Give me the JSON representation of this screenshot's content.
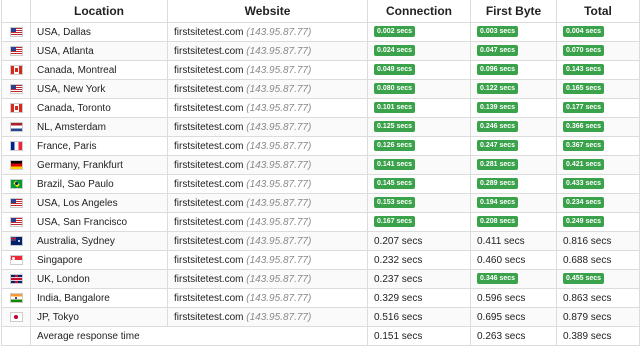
{
  "headers": {
    "flag": "",
    "location": "Location",
    "website": "Website",
    "connection": "Connection",
    "first_byte": "First Byte",
    "total": "Total"
  },
  "colors": {
    "badge_green": "#3aa24a",
    "ip_gray": "#8a8a8a",
    "border": "#dcdcdc"
  },
  "rows": [
    {
      "flag": "us",
      "flag_icon": "us-flag-icon",
      "location": "USA, Dallas",
      "host": "firstsitetest.com",
      "ip": "(143.95.87.77)",
      "connection": "0.002 secs",
      "first_byte": "0.003 secs",
      "total": "0.004 secs",
      "badge_connection": true,
      "badge_first_byte": true,
      "badge_total": true
    },
    {
      "flag": "us",
      "flag_icon": "us-flag-icon",
      "location": "USA, Atlanta",
      "host": "firstsitetest.com",
      "ip": "(143.95.87.77)",
      "connection": "0.024 secs",
      "first_byte": "0.047 secs",
      "total": "0.070 secs",
      "badge_connection": true,
      "badge_first_byte": true,
      "badge_total": true
    },
    {
      "flag": "ca",
      "flag_icon": "canada-flag-icon",
      "location": "Canada, Montreal",
      "host": "firstsitetest.com",
      "ip": "(143.95.87.77)",
      "connection": "0.049 secs",
      "first_byte": "0.096 secs",
      "total": "0.143 secs",
      "badge_connection": true,
      "badge_first_byte": true,
      "badge_total": true
    },
    {
      "flag": "us",
      "flag_icon": "us-flag-icon",
      "location": "USA, New York",
      "host": "firstsitetest.com",
      "ip": "(143.95.87.77)",
      "connection": "0.080 secs",
      "first_byte": "0.122 secs",
      "total": "0.165 secs",
      "badge_connection": true,
      "badge_first_byte": true,
      "badge_total": true
    },
    {
      "flag": "ca",
      "flag_icon": "canada-flag-icon",
      "location": "Canada, Toronto",
      "host": "firstsitetest.com",
      "ip": "(143.95.87.77)",
      "connection": "0.101 secs",
      "first_byte": "0.139 secs",
      "total": "0.177 secs",
      "badge_connection": true,
      "badge_first_byte": true,
      "badge_total": true
    },
    {
      "flag": "nl",
      "flag_icon": "netherlands-flag-icon",
      "location": "NL, Amsterdam",
      "host": "firstsitetest.com",
      "ip": "(143.95.87.77)",
      "connection": "0.125 secs",
      "first_byte": "0.246 secs",
      "total": "0.366 secs",
      "badge_connection": true,
      "badge_first_byte": true,
      "badge_total": true
    },
    {
      "flag": "fr",
      "flag_icon": "france-flag-icon",
      "location": "France, Paris",
      "host": "firstsitetest.com",
      "ip": "(143.95.87.77)",
      "connection": "0.126 secs",
      "first_byte": "0.247 secs",
      "total": "0.367 secs",
      "badge_connection": true,
      "badge_first_byte": true,
      "badge_total": true
    },
    {
      "flag": "de",
      "flag_icon": "germany-flag-icon",
      "location": "Germany, Frankfurt",
      "host": "firstsitetest.com",
      "ip": "(143.95.87.77)",
      "connection": "0.141 secs",
      "first_byte": "0.281 secs",
      "total": "0.421 secs",
      "badge_connection": true,
      "badge_first_byte": true,
      "badge_total": true
    },
    {
      "flag": "br",
      "flag_icon": "brazil-flag-icon",
      "location": "Brazil, Sao Paulo",
      "host": "firstsitetest.com",
      "ip": "(143.95.87.77)",
      "connection": "0.145 secs",
      "first_byte": "0.289 secs",
      "total": "0.433 secs",
      "badge_connection": true,
      "badge_first_byte": true,
      "badge_total": true
    },
    {
      "flag": "us",
      "flag_icon": "us-flag-icon",
      "location": "USA, Los Angeles",
      "host": "firstsitetest.com",
      "ip": "(143.95.87.77)",
      "connection": "0.153 secs",
      "first_byte": "0.194 secs",
      "total": "0.234 secs",
      "badge_connection": true,
      "badge_first_byte": true,
      "badge_total": true
    },
    {
      "flag": "us",
      "flag_icon": "us-flag-icon",
      "location": "USA, San Francisco",
      "host": "firstsitetest.com",
      "ip": "(143.95.87.77)",
      "connection": "0.167 secs",
      "first_byte": "0.208 secs",
      "total": "0.249 secs",
      "badge_connection": true,
      "badge_first_byte": true,
      "badge_total": true
    },
    {
      "flag": "au",
      "flag_icon": "australia-flag-icon",
      "location": "Australia, Sydney",
      "host": "firstsitetest.com",
      "ip": "(143.95.87.77)",
      "connection": "0.207 secs",
      "first_byte": "0.411 secs",
      "total": "0.816 secs",
      "badge_connection": false,
      "badge_first_byte": false,
      "badge_total": false
    },
    {
      "flag": "sg",
      "flag_icon": "singapore-flag-icon",
      "location": "Singapore",
      "host": "firstsitetest.com",
      "ip": "(143.95.87.77)",
      "connection": "0.232 secs",
      "first_byte": "0.460 secs",
      "total": "0.688 secs",
      "badge_connection": false,
      "badge_first_byte": false,
      "badge_total": false
    },
    {
      "flag": "gb",
      "flag_icon": "uk-flag-icon",
      "location": "UK, London",
      "host": "firstsitetest.com",
      "ip": "(143.95.87.77)",
      "connection": "0.237 secs",
      "first_byte": "0.346 secs",
      "total": "0.455 secs",
      "badge_connection": false,
      "badge_first_byte": true,
      "badge_total": true
    },
    {
      "flag": "in",
      "flag_icon": "india-flag-icon",
      "location": "India, Bangalore",
      "host": "firstsitetest.com",
      "ip": "(143.95.87.77)",
      "connection": "0.329 secs",
      "first_byte": "0.596 secs",
      "total": "0.863 secs",
      "badge_connection": false,
      "badge_first_byte": false,
      "badge_total": false
    },
    {
      "flag": "jp",
      "flag_icon": "japan-flag-icon",
      "location": "JP, Tokyo",
      "host": "firstsitetest.com",
      "ip": "(143.95.87.77)",
      "connection": "0.516 secs",
      "first_byte": "0.695 secs",
      "total": "0.879 secs",
      "badge_connection": false,
      "badge_first_byte": false,
      "badge_total": false
    }
  ],
  "average": {
    "label": "Average response time",
    "connection": "0.151 secs",
    "first_byte": "0.263 secs",
    "total": "0.389 secs"
  }
}
